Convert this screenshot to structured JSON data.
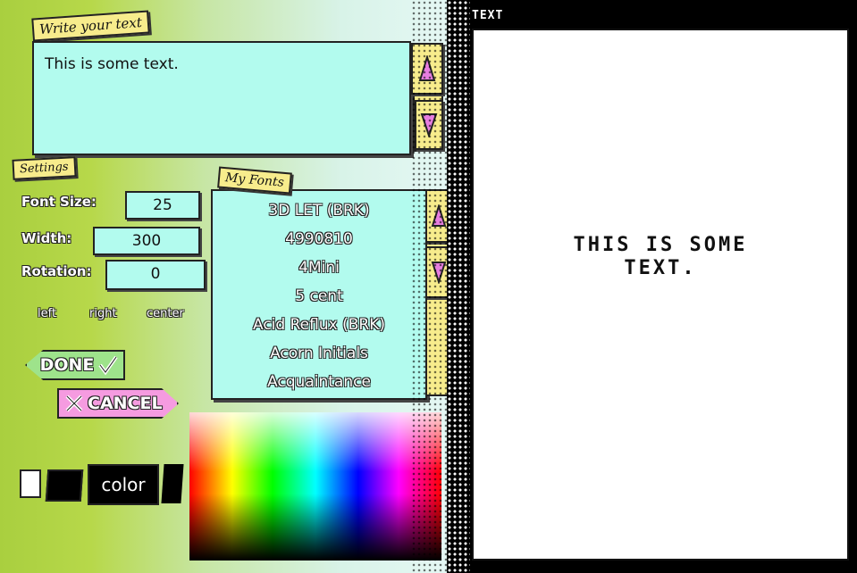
{
  "editor": {
    "write_tag": "Write your text",
    "text_value": "This is some text.",
    "settings_tag": "Settings",
    "font_size_label": "Font Size:",
    "font_size_value": "25",
    "width_label": "Width:",
    "width_value": "300",
    "rotation_label": "Rotation:",
    "rotation_value": "0",
    "align_left": "left",
    "align_right": "right",
    "align_center": "center",
    "done_label": "DONE",
    "cancel_label": "CANCEL",
    "color_label": "color",
    "colors": {
      "panel": "#b2fbee",
      "tag": "#f7ec8c",
      "done": "#9ee38b",
      "cancel": "#f59be0"
    }
  },
  "fonts": {
    "tag": "My Fonts",
    "items": [
      "3D LET (BRK)",
      "4990810",
      "4Mini",
      "5 cent",
      "Acid Reflux (BRK)",
      "Acorn Initials",
      "Acquaintance"
    ]
  },
  "preview": {
    "title": "TEXT",
    "line1": "This is some",
    "line2": "text."
  }
}
